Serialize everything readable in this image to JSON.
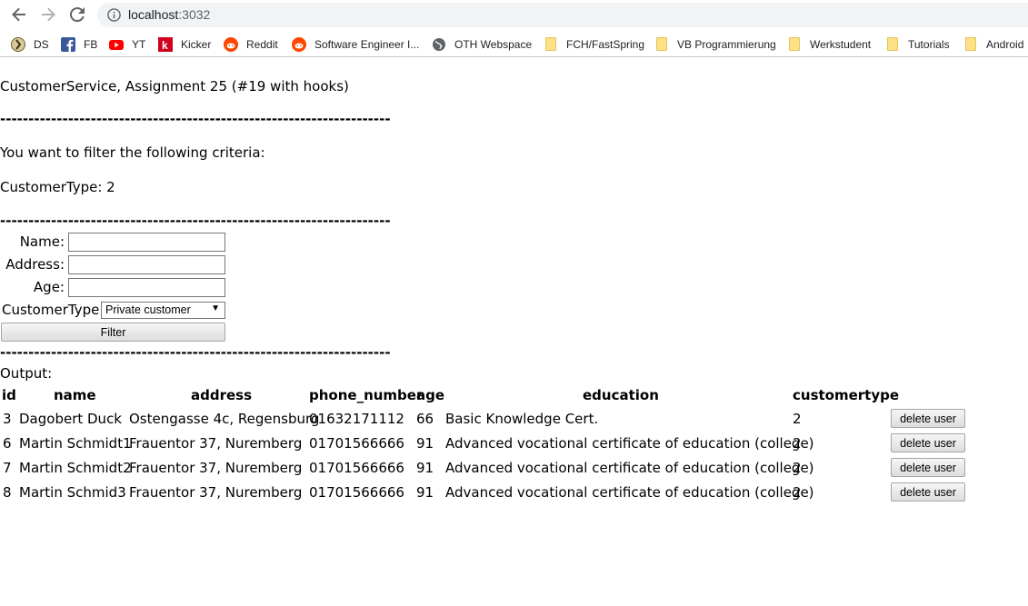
{
  "browser": {
    "url_host": "localhost",
    "url_port": ":3032",
    "bookmarks": [
      {
        "label": "DS",
        "icon": "ds-icon"
      },
      {
        "label": "FB",
        "icon": "facebook-icon"
      },
      {
        "label": "YT",
        "icon": "youtube-icon"
      },
      {
        "label": "Kicker",
        "icon": "kicker-icon"
      },
      {
        "label": "Reddit",
        "icon": "reddit-icon"
      },
      {
        "label": "Software Engineer I...",
        "icon": "reddit-icon"
      },
      {
        "label": "OTH Webspace",
        "icon": "globe-icon"
      },
      {
        "label": "FCH/FastSpring",
        "icon": "folder-icon"
      },
      {
        "label": "VB Programmierung",
        "icon": "folder-icon"
      },
      {
        "label": "Werkstudent",
        "icon": "folder-icon"
      },
      {
        "label": "Tutorials",
        "icon": "folder-icon"
      },
      {
        "label": "Android",
        "icon": "folder-icon"
      }
    ]
  },
  "page": {
    "title": "CustomerService, Assignment 25 (#19 with hooks)",
    "separator": "---------------------------------------------------------------------",
    "filter_intro": "You want to filter the following criteria:",
    "filter_criteria": "CustomerType: 2",
    "form": {
      "name_label": "Name:",
      "address_label": "Address:",
      "age_label": "Age:",
      "customertype_label": "CustomerType:",
      "name_value": "",
      "address_value": "",
      "age_value": "",
      "customertype_selected": "Private customer",
      "filter_button": "Filter"
    },
    "output_label": "Output:",
    "table": {
      "headers": [
        "id",
        "name",
        "address",
        "phone_number",
        "age",
        "education",
        "customertype"
      ],
      "rows": [
        {
          "id": "3",
          "name": "Dagobert Duck",
          "address": "Ostengasse 4c, Regensburg",
          "phone": "01632171112",
          "age": "66",
          "education": "Basic Knowledge Cert.",
          "customertype": "2",
          "action": "delete user"
        },
        {
          "id": "6",
          "name": "Martin Schmidt1",
          "address": "Frauentor 37, Nuremberg",
          "phone": "01701566666",
          "age": "91",
          "education": "Advanced vocational certificate of education (college)",
          "customertype": "2",
          "action": "delete user"
        },
        {
          "id": "7",
          "name": "Martin Schmidt2",
          "address": "Frauentor 37, Nuremberg",
          "phone": "01701566666",
          "age": "91",
          "education": "Advanced vocational certificate of education (college)",
          "customertype": "2",
          "action": "delete user"
        },
        {
          "id": "8",
          "name": "Martin Schmid3",
          "address": "Frauentor 37, Nuremberg",
          "phone": "01701566666",
          "age": "91",
          "education": "Advanced vocational certificate of education (college)",
          "customertype": "2",
          "action": "delete user"
        }
      ]
    }
  }
}
